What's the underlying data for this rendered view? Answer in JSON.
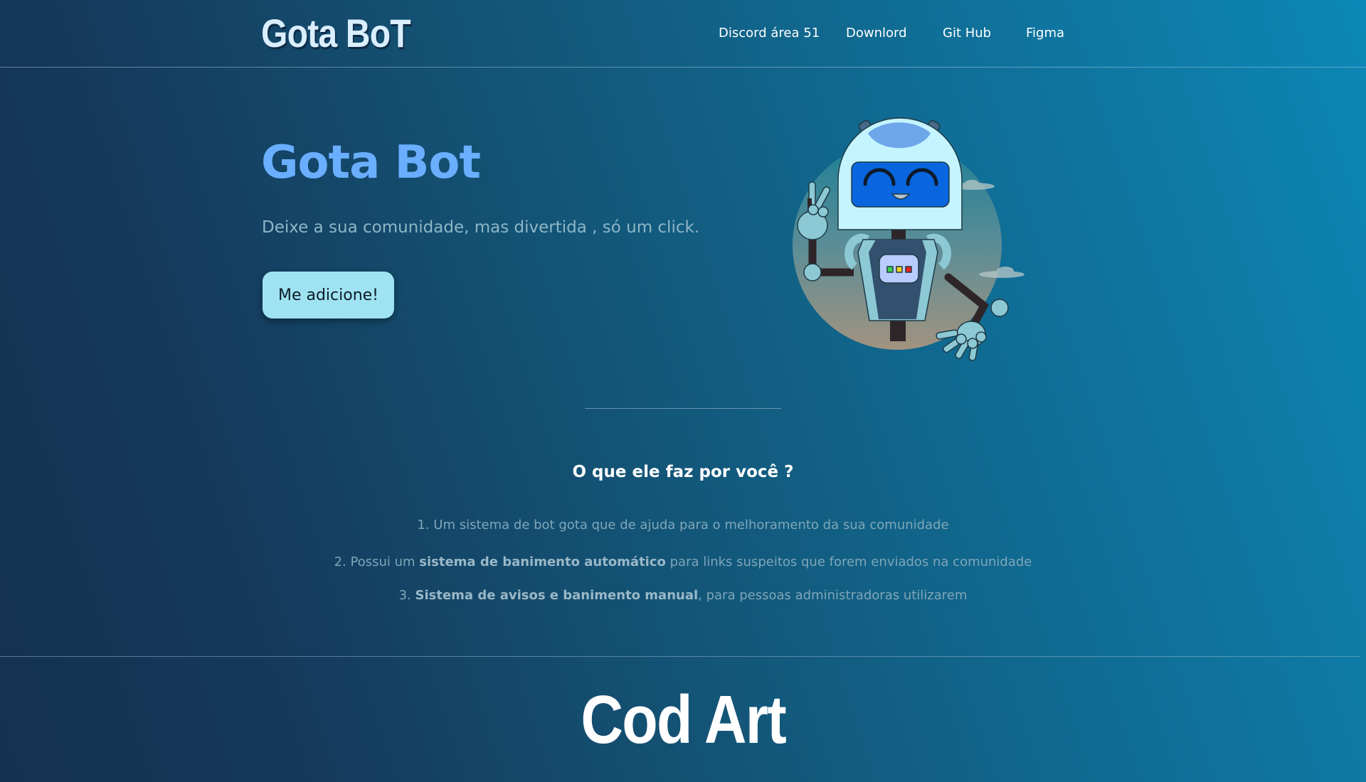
{
  "header": {
    "logo": "Gota BoT",
    "nav": [
      {
        "label": "Discord área 51"
      },
      {
        "label": "Downlord"
      },
      {
        "label": "Git Hub"
      },
      {
        "label": "Figma"
      }
    ]
  },
  "hero": {
    "title": "Gota Bot",
    "subtitle": "Deixe a sua comunidade, mas divertida , só um click.",
    "cta_label": "Me adicione!",
    "illustration": "robot-waving-illustration"
  },
  "features": {
    "title": "O que ele faz por você ?",
    "items": [
      {
        "prefix": "1. Um sistema de bot gota que de ajuda para o melhoramento da sua comunidade",
        "bold": "",
        "suffix": ""
      },
      {
        "prefix": "2. Possui um ",
        "bold": "sistema de banimento automático",
        "suffix": " para links suspeitos que forem enviados na comunidade"
      },
      {
        "prefix": "3. ",
        "bold": "Sistema de avisos e banimento manual",
        "suffix": ", para pessoas administradoras utilizarem"
      }
    ]
  },
  "footer": {
    "brand": "Cod Art"
  },
  "colors": {
    "accent_title": "#6aaeff",
    "cta_bg": "#9fe3f2",
    "logo": "#d9efff"
  }
}
